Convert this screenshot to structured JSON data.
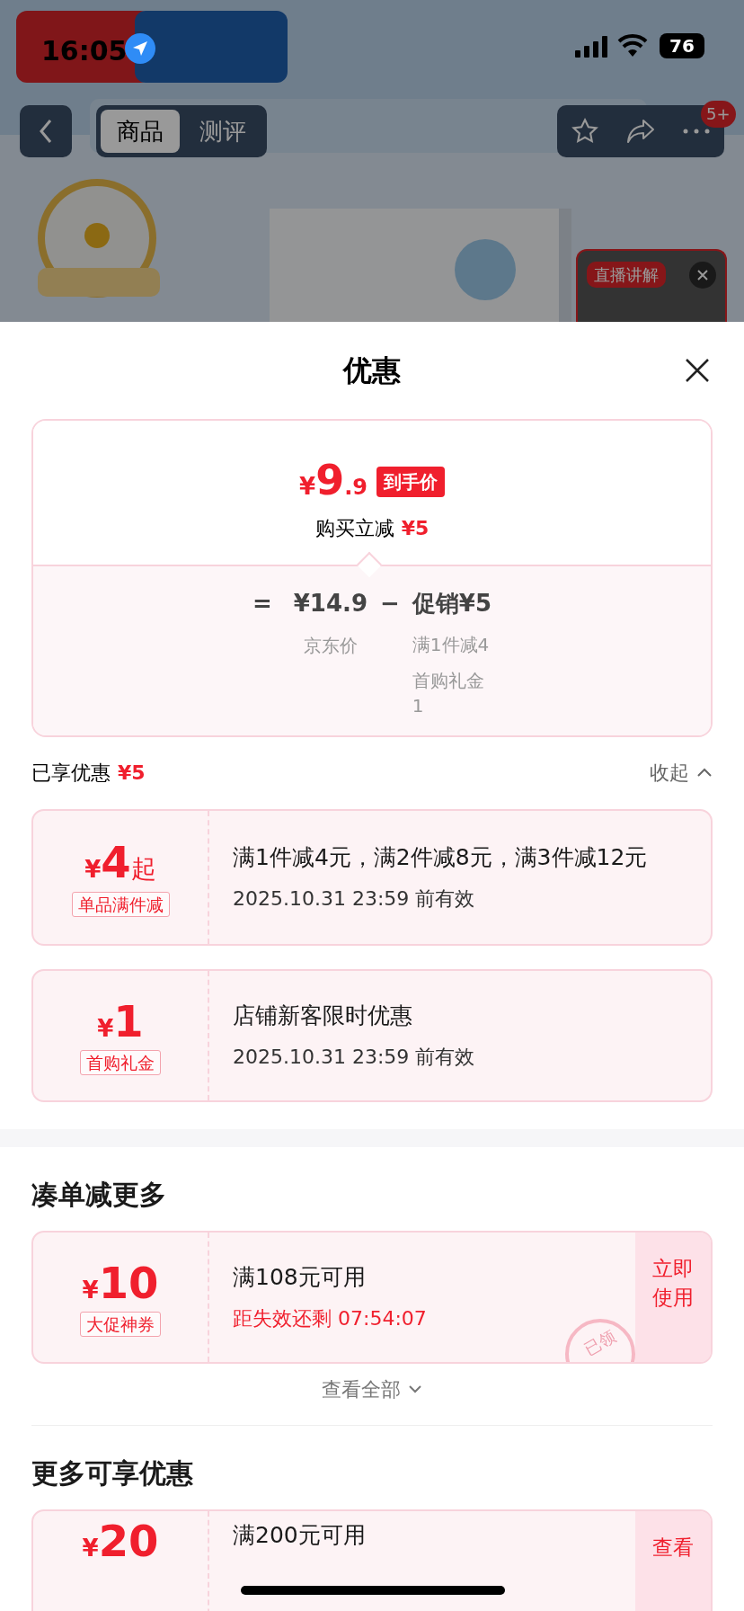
{
  "status_bar": {
    "time": "16:05",
    "battery": "76"
  },
  "nav": {
    "tabs": [
      {
        "label": "商品",
        "selected": true
      },
      {
        "label": "测评",
        "selected": false
      }
    ],
    "badge": "5+"
  },
  "live_tile": {
    "label": "直播讲解"
  },
  "sheet": {
    "title": "优惠",
    "price": {
      "currency": "¥",
      "integer": "9",
      "decimal": ".9",
      "tag": "到手价",
      "instant_label": "购买立减",
      "instant_value": "¥5",
      "equals": "=",
      "base_price": "¥14.9",
      "base_label": "京东价",
      "minus": "−",
      "promo": "促销¥5",
      "promo_details": [
        "满1件减4",
        "首购礼金1"
      ]
    },
    "enjoyed": {
      "label": "已享优惠",
      "amount": "¥5",
      "toggle": "收起",
      "expanded": true
    },
    "applied_coupons": [
      {
        "currency": "¥",
        "amount": "4",
        "suffix": "起",
        "tag": "单品满件减",
        "title": "满1件减4元，满2件减8元，满3件减12元",
        "validity": "2025.10.31 23:59 前有效"
      },
      {
        "currency": "¥",
        "amount": "1",
        "tag": "首购礼金",
        "title": "店铺新客限时优惠",
        "validity": "2025.10.31 23:59 前有效"
      }
    ],
    "sections": [
      {
        "title": "凑单减更多",
        "coupons": [
          {
            "currency": "¥",
            "amount": "10",
            "tag": "大促神券",
            "title": "满108元可用",
            "countdown": "距失效还剩 07:54:07",
            "action": "立即使用",
            "stamp": "已领"
          }
        ],
        "view_all": "查看全部"
      },
      {
        "title": "更多可享优惠",
        "coupons": [
          {
            "currency": "¥",
            "amount": "20",
            "title": "满200元可用",
            "action": "查看"
          }
        ]
      }
    ]
  }
}
